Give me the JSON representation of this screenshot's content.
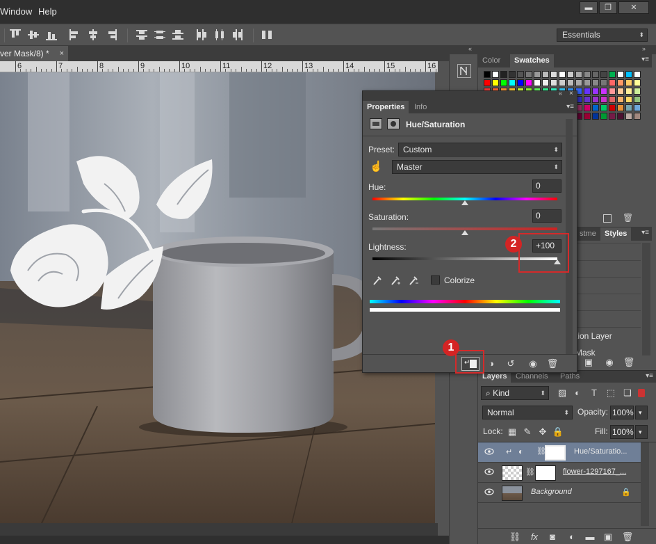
{
  "menu": {
    "items": [
      "Window",
      "Help"
    ]
  },
  "window_buttons": {
    "minimize": "▬",
    "restore": "❐",
    "close": "✕"
  },
  "workspace": {
    "label": "Essentials"
  },
  "document": {
    "tab_title": "ver Mask/8) *",
    "close_glyph": "×",
    "ruler_numbers": [
      "6",
      "7",
      "8",
      "9",
      "10",
      "11",
      "12",
      "13",
      "14",
      "15",
      "16"
    ]
  },
  "swatches_panel": {
    "tabs": [
      "Color",
      "Swatches"
    ],
    "active_tab": "Swatches"
  },
  "mid_panel": {
    "tabs": [
      "stme",
      "Styles"
    ],
    "items": [
      "tion Layer",
      "Mask"
    ]
  },
  "properties_panel": {
    "tabs": [
      "Properties",
      "Info"
    ],
    "active_tab": "Properties",
    "adjustment_title": "Hue/Saturation",
    "preset_label": "Preset:",
    "preset_value": "Custom",
    "channel_value": "Master",
    "hue_label": "Hue:",
    "hue_value": "0",
    "saturation_label": "Saturation:",
    "saturation_value": "0",
    "lightness_label": "Lightness:",
    "lightness_value": "+100",
    "hue_position": 0.5,
    "saturation_position": 0.5,
    "lightness_position": 1.0,
    "colorize_label": "Colorize",
    "colorize_checked": false
  },
  "annotations": {
    "badge_1": "1",
    "badge_2": "2",
    "color": "#d42a2a"
  },
  "layers_panel": {
    "tabs": [
      "Layers",
      "Channels",
      "Paths"
    ],
    "active_tab": "Layers",
    "filter_kind": "Kind",
    "blend_mode": "Normal",
    "opacity_label": "Opacity:",
    "opacity_value": "100%",
    "lock_label": "Lock:",
    "fill_label": "Fill:",
    "fill_value": "100%",
    "layers": [
      {
        "name": "Hue/Saturatio...",
        "type": "adjustment",
        "selected": true
      },
      {
        "name": "flower-1297167_...",
        "type": "masked"
      },
      {
        "name": "Background",
        "type": "background",
        "locked": true
      }
    ]
  },
  "colors": {
    "ui_dark": "#3c3c3c",
    "ui_mid": "#535353",
    "selected_layer": "#6f7f97",
    "annotation_red": "#d42a2a"
  }
}
